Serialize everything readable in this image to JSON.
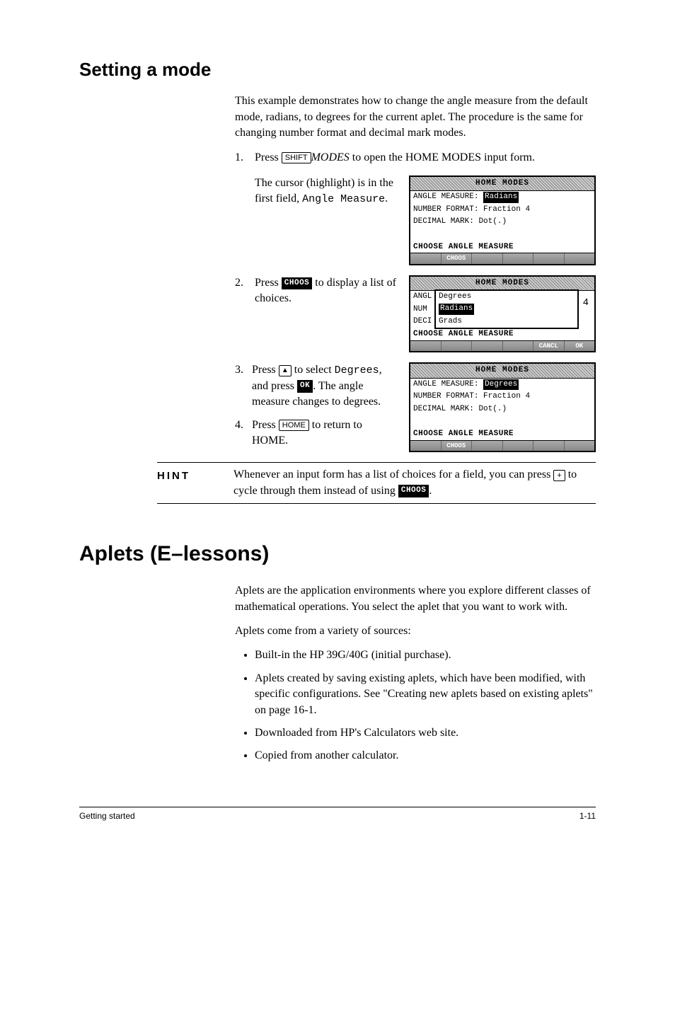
{
  "section1_title": "Setting a mode",
  "intro": "This example demonstrates how to change the angle measure from the default mode, radians, to degrees for the current aplet. The procedure is the same for changing number format and decimal mark modes.",
  "step1_pre": "Press ",
  "key_shift": "SHIFT",
  "step1_modes": "MODES",
  "step1_post": " to open the HOME MODES input form.",
  "step1b": "The cursor (highlight) is in the first field, ",
  "step1b_mono": "Angle Measure",
  "step1b_end": ".",
  "step2_pre": "Press ",
  "soft_choos": "CHOOS",
  "step2_post": " to display a list of choices.",
  "step3_pre": "Press ",
  "step3_mid": " to select ",
  "step3_mono": "Degrees",
  "step3_mid2": ", and press ",
  "soft_ok": "OK",
  "step3_post": ". The angle measure changes to degrees.",
  "step4_pre": "Press ",
  "key_home": "HOME",
  "step4_post": " to return to HOME.",
  "calc": {
    "title": "HOME MODES",
    "angle_label": "ANGLE MEASURE:",
    "radians": "Radians",
    "degrees": "Degrees",
    "grads": "Grads",
    "numfmt_label": "NUMBER FORMAT:",
    "numfmt_val": "Fraction",
    "numfmt_n": "4",
    "dec_label": "DECIMAL MARK:",
    "dec_val": "Dot(.)",
    "choose_hint": "CHOOSE ANGLE MEASURE",
    "sk_cancl": "CANCL",
    "sk_ok": "OK",
    "angl_short": "ANGL",
    "num_short": "NUM",
    "deci_short": "DECI"
  },
  "hint_label": "HINT",
  "hint_text1": "Whenever an input form has a list of choices for a field, you can press ",
  "key_plus": "+",
  "hint_text2": " to cycle through them instead of using ",
  "hint_text3": ".",
  "section2_title": "Aplets (E–lessons)",
  "aplets_p1": "Aplets are the application environments where you explore different classes of mathematical operations. You select the aplet that you want to work with.",
  "aplets_p2": "Aplets come from a variety of sources:",
  "bullets": {
    "b1": "Built-in the HP 39G/40G (initial purchase).",
    "b2": "Aplets created by saving existing aplets, which have been modified, with specific configurations. See \"Creating new aplets based on existing aplets\" on page 16-1.",
    "b3": "Downloaded from HP's Calculators web site.",
    "b4": "Copied from another calculator."
  },
  "footer_left": "Getting started",
  "footer_right": "1-11"
}
